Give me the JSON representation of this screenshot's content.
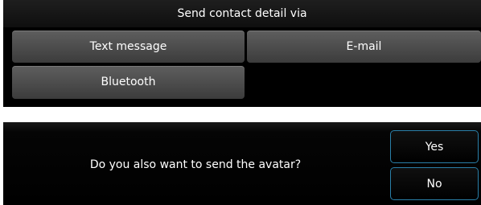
{
  "send_dialog": {
    "title": "Send contact detail via",
    "options": [
      {
        "label": "Text message"
      },
      {
        "label": "E-mail"
      },
      {
        "label": "Bluetooth"
      }
    ]
  },
  "avatar_dialog": {
    "question": "Do you also want to send the avatar?",
    "yes_label": "Yes",
    "no_label": "No"
  },
  "colors": {
    "dialog_background": "#000000",
    "button_gray": "#4d4d4d",
    "accent_border": "#2a7fa8"
  }
}
